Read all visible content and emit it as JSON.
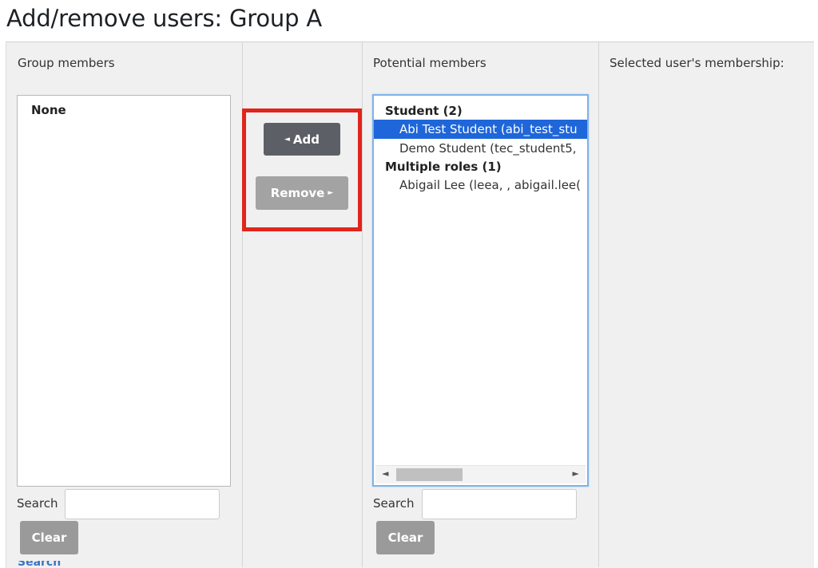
{
  "page": {
    "title": "Add/remove users: Group A"
  },
  "group_members": {
    "heading": "Group members",
    "empty_text": "None",
    "search_label": "Search",
    "search_value": "",
    "clear_label": "Clear"
  },
  "actions": {
    "add_label": "Add",
    "add_arrow": "◄",
    "remove_label": "Remove",
    "remove_arrow": "►"
  },
  "potential_members": {
    "heading": "Potential members",
    "groups": [
      {
        "label": "Student (2)",
        "options": [
          "Abi Test Student (abi_test_stu",
          "Demo Student (tec_student5,"
        ]
      },
      {
        "label": "Multiple roles (1)",
        "options": [
          "Abigail Lee (leea, , abigail.lee("
        ]
      }
    ],
    "selected_option": "Abi Test Student (abi_test_stu",
    "search_label": "Search",
    "search_value": "",
    "clear_label": "Clear"
  },
  "membership": {
    "heading": "Selected user's membership:"
  },
  "footer": {
    "partial_link": "Search options"
  },
  "icons": {
    "scroll_left": "scroll-left-arrow-icon",
    "scroll_right": "scroll-right-arrow-icon",
    "add_arrow": "arrow-left-icon",
    "remove_arrow": "arrow-right-icon"
  },
  "colors": {
    "selected_bg": "#1e66d9",
    "add_button": "#5c6066",
    "remove_button": "#a3a3a3",
    "highlight": "#e1251b"
  }
}
